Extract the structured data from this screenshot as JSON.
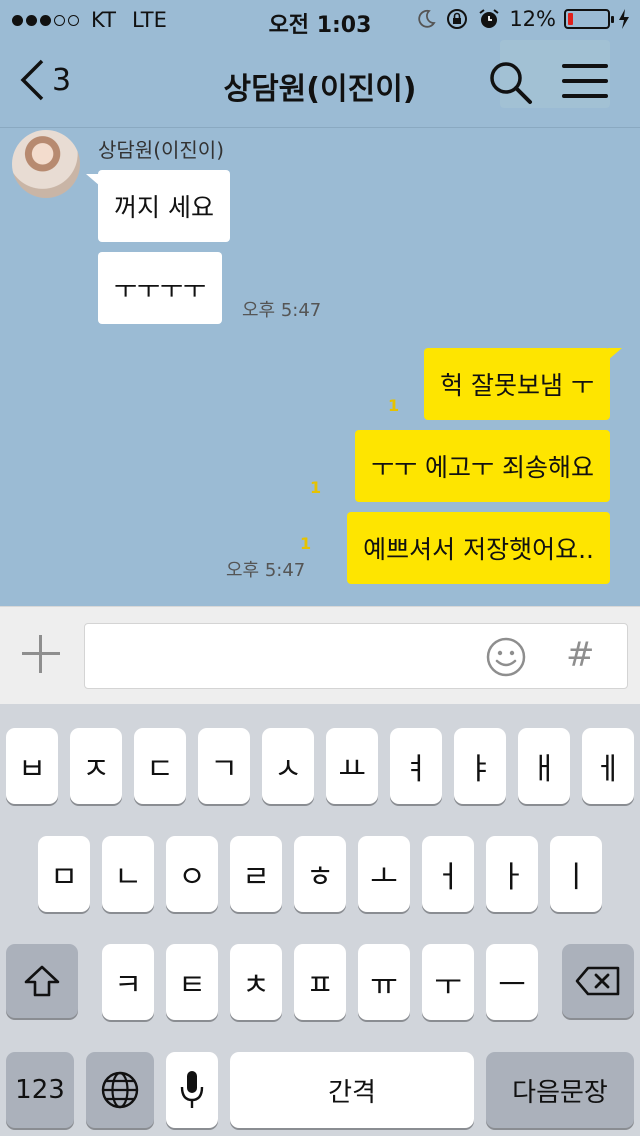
{
  "status_bar": {
    "carrier": "KT",
    "network": "LTE",
    "time": "오전 1:03",
    "battery_percent": "12%",
    "battery_level": 0.12,
    "signal_bars": 3,
    "signal_total": 5,
    "icons": [
      "moon-icon",
      "rotation-lock-icon",
      "alarm-icon",
      "charging-icon"
    ]
  },
  "nav": {
    "back_count": "3",
    "title": "상담원(이진이)",
    "search_icon": "search-icon",
    "menu_icon": "menu-icon"
  },
  "chat": {
    "sender_name": "상담원(이진이)",
    "incoming": [
      {
        "text": "꺼지 세요"
      },
      {
        "text": "ㅜㅜㅜㅜ",
        "time": "오후 5:47"
      }
    ],
    "outgoing": [
      {
        "text": "헉 잘못보냄 ㅜ",
        "unread": "1"
      },
      {
        "text": "ㅜㅜ 에고ㅜ 죄송해요",
        "unread": "1"
      },
      {
        "text": "예쁘셔서 저장햇어요..",
        "unread": "1",
        "time": "오후 5:47"
      }
    ]
  },
  "input_bar": {
    "message_value": "",
    "hash_label": "#"
  },
  "keyboard": {
    "row1": [
      "ㅂ",
      "ㅈ",
      "ㄷ",
      "ㄱ",
      "ㅅ",
      "ㅛ",
      "ㅕ",
      "ㅑ",
      "ㅐ",
      "ㅔ"
    ],
    "row2": [
      "ㅁ",
      "ㄴ",
      "ㅇ",
      "ㄹ",
      "ㅎ",
      "ㅗ",
      "ㅓ",
      "ㅏ",
      "ㅣ"
    ],
    "row3": [
      "ㅋ",
      "ㅌ",
      "ㅊ",
      "ㅍ",
      "ㅠ",
      "ㅜ",
      "ㅡ"
    ],
    "numbers_label": "123",
    "space_label": "간격",
    "return_label": "다음문장"
  },
  "colors": {
    "chat_background": "#9bbbd4",
    "outgoing_bubble": "#fee500",
    "incoming_bubble": "#ffffff",
    "battery_low": "#e0201b"
  }
}
